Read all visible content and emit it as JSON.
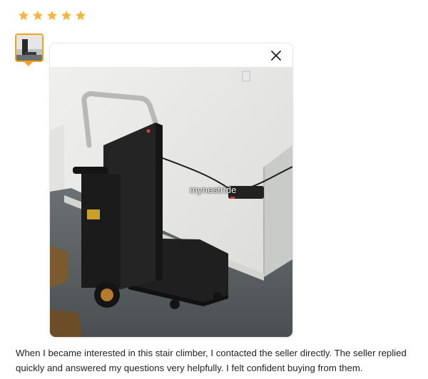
{
  "rating": {
    "value": 5,
    "max": 5,
    "color": "#f4b63f"
  },
  "thumbnail": {
    "icon": "product-photo-thumbnail",
    "accent_color": "#f3a21b"
  },
  "popup": {
    "close_icon": "close-icon",
    "photo_watermark": "mynestride"
  },
  "review": {
    "text": "When I became interested in this stair climber, I contacted the seller directly. The seller replied quickly and answered my questions very helpfully. I felt confident buying from them."
  }
}
